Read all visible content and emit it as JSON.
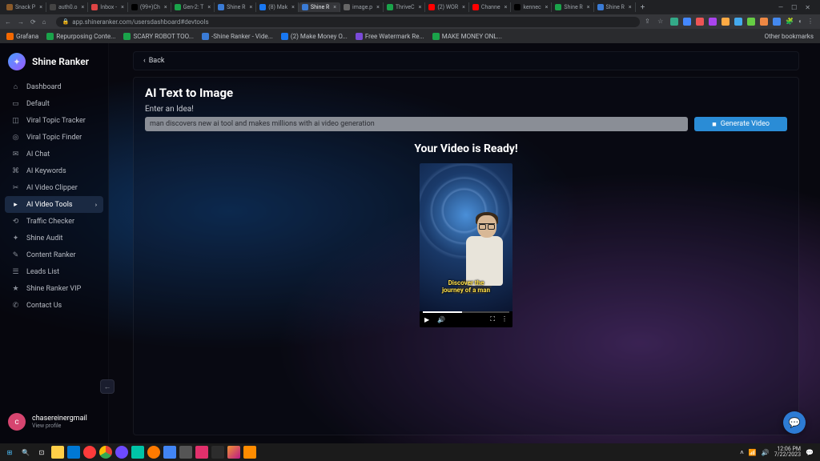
{
  "browser": {
    "tabs": [
      {
        "label": "Snack P",
        "fav": "#8a5a2a"
      },
      {
        "label": "auth0.o",
        "fav": "#444"
      },
      {
        "label": "Inbox -",
        "fav": "#d44"
      },
      {
        "label": "(99+)Ch",
        "fav": "#000"
      },
      {
        "label": "Gen-2: T",
        "fav": "#1aa34a"
      },
      {
        "label": "Shine R",
        "fav": "#3a7bd5"
      },
      {
        "label": "(8) Mak",
        "fav": "#1877f2"
      },
      {
        "label": "Shine R",
        "fav": "#3a7bd5",
        "active": true
      },
      {
        "label": "image.p",
        "fav": "#666"
      },
      {
        "label": "ThriveC",
        "fav": "#1aa34a"
      },
      {
        "label": "(2) WOR",
        "fav": "#ff0000"
      },
      {
        "label": "Channe",
        "fav": "#ff0000"
      },
      {
        "label": "kennec",
        "fav": "#000"
      },
      {
        "label": "Shine R",
        "fav": "#1aa34a"
      },
      {
        "label": "Shine R",
        "fav": "#3a7bd5"
      }
    ],
    "url": "app.shineranker.com/usersdashboard#devtools",
    "bookmarks": [
      {
        "label": "Grafana",
        "color": "#f46800"
      },
      {
        "label": "Repurposing Conte...",
        "color": "#1aa34a"
      },
      {
        "label": "SCARY ROBOT TOO...",
        "color": "#1aa34a"
      },
      {
        "label": "-Shine Ranker - Vide...",
        "color": "#3a7bd5"
      },
      {
        "label": "(2) Make Money O...",
        "color": "#1877f2"
      },
      {
        "label": "Free Watermark Re...",
        "color": "#7a4ad8"
      },
      {
        "label": "MAKE MONEY ONL...",
        "color": "#1aa34a"
      }
    ],
    "other_bookmarks": "Other bookmarks"
  },
  "sidebar": {
    "brand": "Shine Ranker",
    "items": [
      {
        "icon": "⌂",
        "label": "Dashboard"
      },
      {
        "icon": "▭",
        "label": "Default"
      },
      {
        "icon": "◫",
        "label": "Viral Topic Tracker"
      },
      {
        "icon": "◎",
        "label": "Viral Topic Finder"
      },
      {
        "icon": "✉",
        "label": "AI Chat"
      },
      {
        "icon": "⌘",
        "label": "AI Keywords"
      },
      {
        "icon": "✂",
        "label": "AI Video Clipper"
      },
      {
        "icon": "▸",
        "label": "AI Video Tools",
        "active": true,
        "chev": true
      },
      {
        "icon": "⟲",
        "label": "Traffic Checker"
      },
      {
        "icon": "✦",
        "label": "Shine Audit"
      },
      {
        "icon": "✎",
        "label": "Content Ranker"
      },
      {
        "icon": "☰",
        "label": "Leads List"
      },
      {
        "icon": "★",
        "label": "Shine Ranker VIP"
      },
      {
        "icon": "✆",
        "label": "Contact Us"
      }
    ],
    "user": {
      "name": "chasereinergmail",
      "sub": "View profile",
      "initial": "c"
    }
  },
  "main": {
    "back": "Back",
    "title": "AI Text to Image",
    "prompt_label": "Enter an Idea!",
    "input_value": "man discovers new ai tool and makes millions with ai video generation",
    "generate_btn": "Generate Video",
    "ready_heading": "Your Video is Ready!",
    "caption_line1": "Discover the",
    "caption_line2": "journey of a man"
  },
  "taskbar": {
    "time": "12:06 PM",
    "date": "7/22/2023"
  }
}
